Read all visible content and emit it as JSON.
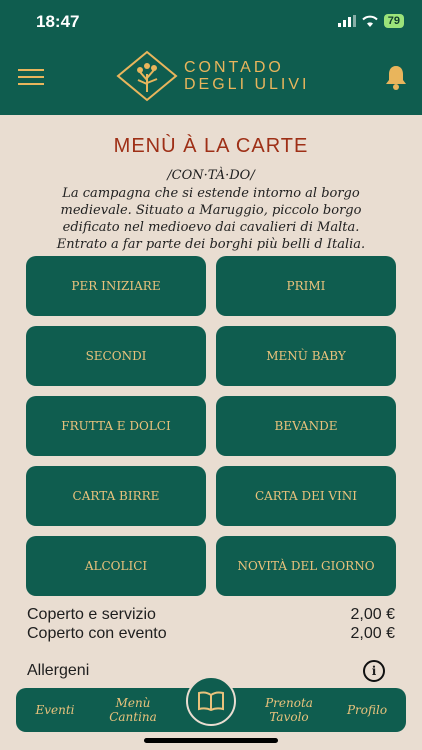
{
  "status": {
    "time": "18:47",
    "battery": "79"
  },
  "header": {
    "logo_line1": "CONTADO",
    "logo_line2": "DEGLI ULIVI",
    "accent": "#e9b55c"
  },
  "page": {
    "title": "MENÙ À LA CARTE",
    "pronunciation": "/CON·TÀ·DO/",
    "description": "La campagna che si estende intorno al borgo medievale. Situato a Maruggio, piccolo borgo edificato nel medioevo dai cavalieri di Malta. Entrato a far parte dei borghi più belli d Italia."
  },
  "menu_buttons": [
    {
      "label": "PER INIZIARE"
    },
    {
      "label": "PRIMI"
    },
    {
      "label": "SECONDI"
    },
    {
      "label": "MENÙ BABY"
    },
    {
      "label": "FRUTTA E DOLCI"
    },
    {
      "label": "BEVANDE"
    },
    {
      "label": "CARTA BIRRE"
    },
    {
      "label": "CARTA DEI VINI"
    },
    {
      "label": "ALCOLICI"
    },
    {
      "label": "NOVITÀ DEL GIORNO"
    }
  ],
  "prices": [
    {
      "label": "Coperto e servizio",
      "value": "2,00 €"
    },
    {
      "label": "Coperto con evento",
      "value": "2,00 €"
    }
  ],
  "allergeni": {
    "label": "Allergeni",
    "icon": "info-icon"
  },
  "tabbar": {
    "tabs": [
      {
        "label": "Eventi"
      },
      {
        "label": "Menù Cantina"
      },
      {
        "label": "Prenota Tavolo"
      },
      {
        "label": "Profilo"
      }
    ],
    "center_icon": "book-icon"
  },
  "colors": {
    "primary": "#0f5d4f",
    "background": "#e9ddd1",
    "title": "#9e2f16",
    "button_text": "#e9c27c"
  }
}
